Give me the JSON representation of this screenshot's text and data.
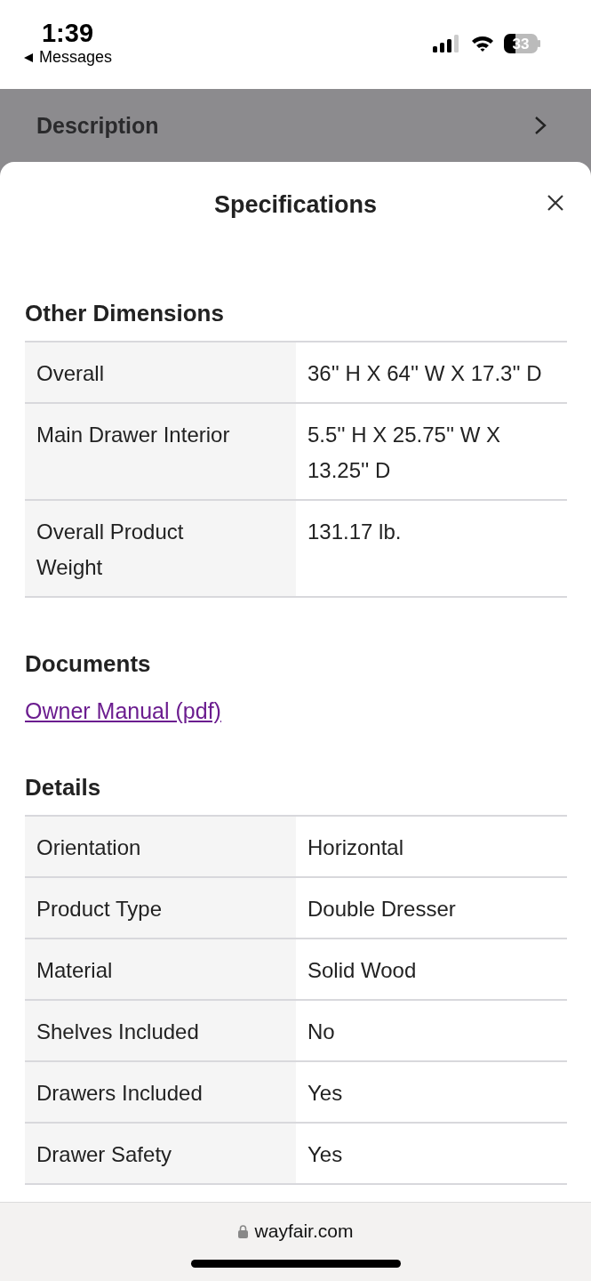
{
  "status_bar": {
    "time": "1:39",
    "back_label": "Messages",
    "battery": "33"
  },
  "backdrop": {
    "title": "Description"
  },
  "sheet": {
    "title": "Specifications"
  },
  "sections": [
    {
      "kind": "table",
      "heading": "Other Dimensions",
      "rows": [
        {
          "label": "Overall",
          "value": "36'' H X 64'' W X 17.3'' D"
        },
        {
          "label": "Main Drawer Interior",
          "value": "5.5'' H X 25.75'' W X 13.25'' D"
        },
        {
          "label": "Overall Product Weight",
          "value": "131.17 lb."
        }
      ]
    },
    {
      "kind": "links",
      "heading": "Documents",
      "links": [
        "Owner Manual (pdf)"
      ]
    },
    {
      "kind": "table",
      "heading": "Details",
      "rows": [
        {
          "label": "Orientation",
          "value": "Horizontal"
        },
        {
          "label": "Product Type",
          "value": "Double Dresser"
        },
        {
          "label": "Material",
          "value": "Solid Wood"
        },
        {
          "label": "Shelves Included",
          "value": "No"
        },
        {
          "label": "Drawers Included",
          "value": "Yes"
        },
        {
          "label": "Drawer Safety",
          "value": "Yes"
        }
      ]
    }
  ],
  "browser_bar": {
    "url": "wayfair.com"
  }
}
